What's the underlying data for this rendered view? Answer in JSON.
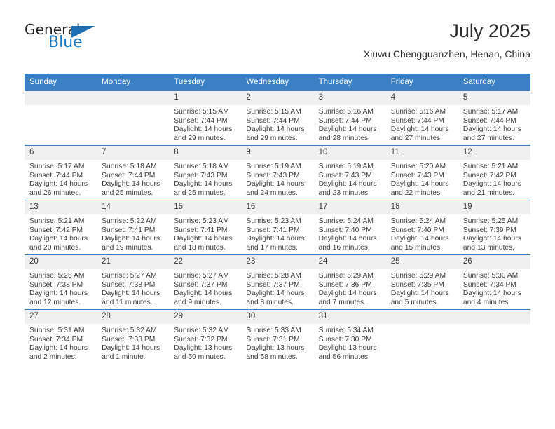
{
  "brand": {
    "name_dark": "General",
    "name_blue": "Blue",
    "color_blue": "#1878c4",
    "color_triangle": "#1f6fb5"
  },
  "header": {
    "title": "July 2025",
    "subtitle": "Xiuwu Chengguanzhen, Henan, China"
  },
  "theme": {
    "header_bg": "#3b7fc4",
    "daynum_bg": "#f0f0f0",
    "grid_line": "#3b7fc4"
  },
  "weekday_headers": [
    "Sunday",
    "Monday",
    "Tuesday",
    "Wednesday",
    "Thursday",
    "Friday",
    "Saturday"
  ],
  "weeks": [
    [
      {
        "day": "",
        "sunrise": "",
        "sunset": "",
        "daylight1": "",
        "daylight2": ""
      },
      {
        "day": "",
        "sunrise": "",
        "sunset": "",
        "daylight1": "",
        "daylight2": ""
      },
      {
        "day": "1",
        "sunrise": "Sunrise: 5:15 AM",
        "sunset": "Sunset: 7:44 PM",
        "daylight1": "Daylight: 14 hours",
        "daylight2": "and 29 minutes."
      },
      {
        "day": "2",
        "sunrise": "Sunrise: 5:15 AM",
        "sunset": "Sunset: 7:44 PM",
        "daylight1": "Daylight: 14 hours",
        "daylight2": "and 29 minutes."
      },
      {
        "day": "3",
        "sunrise": "Sunrise: 5:16 AM",
        "sunset": "Sunset: 7:44 PM",
        "daylight1": "Daylight: 14 hours",
        "daylight2": "and 28 minutes."
      },
      {
        "day": "4",
        "sunrise": "Sunrise: 5:16 AM",
        "sunset": "Sunset: 7:44 PM",
        "daylight1": "Daylight: 14 hours",
        "daylight2": "and 27 minutes."
      },
      {
        "day": "5",
        "sunrise": "Sunrise: 5:17 AM",
        "sunset": "Sunset: 7:44 PM",
        "daylight1": "Daylight: 14 hours",
        "daylight2": "and 27 minutes."
      }
    ],
    [
      {
        "day": "6",
        "sunrise": "Sunrise: 5:17 AM",
        "sunset": "Sunset: 7:44 PM",
        "daylight1": "Daylight: 14 hours",
        "daylight2": "and 26 minutes."
      },
      {
        "day": "7",
        "sunrise": "Sunrise: 5:18 AM",
        "sunset": "Sunset: 7:44 PM",
        "daylight1": "Daylight: 14 hours",
        "daylight2": "and 25 minutes."
      },
      {
        "day": "8",
        "sunrise": "Sunrise: 5:18 AM",
        "sunset": "Sunset: 7:43 PM",
        "daylight1": "Daylight: 14 hours",
        "daylight2": "and 25 minutes."
      },
      {
        "day": "9",
        "sunrise": "Sunrise: 5:19 AM",
        "sunset": "Sunset: 7:43 PM",
        "daylight1": "Daylight: 14 hours",
        "daylight2": "and 24 minutes."
      },
      {
        "day": "10",
        "sunrise": "Sunrise: 5:19 AM",
        "sunset": "Sunset: 7:43 PM",
        "daylight1": "Daylight: 14 hours",
        "daylight2": "and 23 minutes."
      },
      {
        "day": "11",
        "sunrise": "Sunrise: 5:20 AM",
        "sunset": "Sunset: 7:43 PM",
        "daylight1": "Daylight: 14 hours",
        "daylight2": "and 22 minutes."
      },
      {
        "day": "12",
        "sunrise": "Sunrise: 5:21 AM",
        "sunset": "Sunset: 7:42 PM",
        "daylight1": "Daylight: 14 hours",
        "daylight2": "and 21 minutes."
      }
    ],
    [
      {
        "day": "13",
        "sunrise": "Sunrise: 5:21 AM",
        "sunset": "Sunset: 7:42 PM",
        "daylight1": "Daylight: 14 hours",
        "daylight2": "and 20 minutes."
      },
      {
        "day": "14",
        "sunrise": "Sunrise: 5:22 AM",
        "sunset": "Sunset: 7:41 PM",
        "daylight1": "Daylight: 14 hours",
        "daylight2": "and 19 minutes."
      },
      {
        "day": "15",
        "sunrise": "Sunrise: 5:23 AM",
        "sunset": "Sunset: 7:41 PM",
        "daylight1": "Daylight: 14 hours",
        "daylight2": "and 18 minutes."
      },
      {
        "day": "16",
        "sunrise": "Sunrise: 5:23 AM",
        "sunset": "Sunset: 7:41 PM",
        "daylight1": "Daylight: 14 hours",
        "daylight2": "and 17 minutes."
      },
      {
        "day": "17",
        "sunrise": "Sunrise: 5:24 AM",
        "sunset": "Sunset: 7:40 PM",
        "daylight1": "Daylight: 14 hours",
        "daylight2": "and 16 minutes."
      },
      {
        "day": "18",
        "sunrise": "Sunrise: 5:24 AM",
        "sunset": "Sunset: 7:40 PM",
        "daylight1": "Daylight: 14 hours",
        "daylight2": "and 15 minutes."
      },
      {
        "day": "19",
        "sunrise": "Sunrise: 5:25 AM",
        "sunset": "Sunset: 7:39 PM",
        "daylight1": "Daylight: 14 hours",
        "daylight2": "and 13 minutes."
      }
    ],
    [
      {
        "day": "20",
        "sunrise": "Sunrise: 5:26 AM",
        "sunset": "Sunset: 7:38 PM",
        "daylight1": "Daylight: 14 hours",
        "daylight2": "and 12 minutes."
      },
      {
        "day": "21",
        "sunrise": "Sunrise: 5:27 AM",
        "sunset": "Sunset: 7:38 PM",
        "daylight1": "Daylight: 14 hours",
        "daylight2": "and 11 minutes."
      },
      {
        "day": "22",
        "sunrise": "Sunrise: 5:27 AM",
        "sunset": "Sunset: 7:37 PM",
        "daylight1": "Daylight: 14 hours",
        "daylight2": "and 9 minutes."
      },
      {
        "day": "23",
        "sunrise": "Sunrise: 5:28 AM",
        "sunset": "Sunset: 7:37 PM",
        "daylight1": "Daylight: 14 hours",
        "daylight2": "and 8 minutes."
      },
      {
        "day": "24",
        "sunrise": "Sunrise: 5:29 AM",
        "sunset": "Sunset: 7:36 PM",
        "daylight1": "Daylight: 14 hours",
        "daylight2": "and 7 minutes."
      },
      {
        "day": "25",
        "sunrise": "Sunrise: 5:29 AM",
        "sunset": "Sunset: 7:35 PM",
        "daylight1": "Daylight: 14 hours",
        "daylight2": "and 5 minutes."
      },
      {
        "day": "26",
        "sunrise": "Sunrise: 5:30 AM",
        "sunset": "Sunset: 7:34 PM",
        "daylight1": "Daylight: 14 hours",
        "daylight2": "and 4 minutes."
      }
    ],
    [
      {
        "day": "27",
        "sunrise": "Sunrise: 5:31 AM",
        "sunset": "Sunset: 7:34 PM",
        "daylight1": "Daylight: 14 hours",
        "daylight2": "and 2 minutes."
      },
      {
        "day": "28",
        "sunrise": "Sunrise: 5:32 AM",
        "sunset": "Sunset: 7:33 PM",
        "daylight1": "Daylight: 14 hours",
        "daylight2": "and 1 minute."
      },
      {
        "day": "29",
        "sunrise": "Sunrise: 5:32 AM",
        "sunset": "Sunset: 7:32 PM",
        "daylight1": "Daylight: 13 hours",
        "daylight2": "and 59 minutes."
      },
      {
        "day": "30",
        "sunrise": "Sunrise: 5:33 AM",
        "sunset": "Sunset: 7:31 PM",
        "daylight1": "Daylight: 13 hours",
        "daylight2": "and 58 minutes."
      },
      {
        "day": "31",
        "sunrise": "Sunrise: 5:34 AM",
        "sunset": "Sunset: 7:30 PM",
        "daylight1": "Daylight: 13 hours",
        "daylight2": "and 56 minutes."
      },
      {
        "day": "",
        "sunrise": "",
        "sunset": "",
        "daylight1": "",
        "daylight2": ""
      },
      {
        "day": "",
        "sunrise": "",
        "sunset": "",
        "daylight1": "",
        "daylight2": ""
      }
    ]
  ]
}
